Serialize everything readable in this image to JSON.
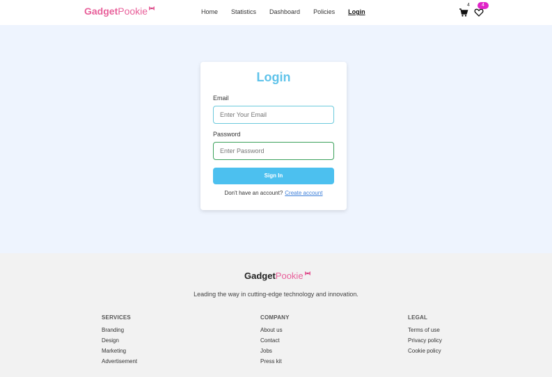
{
  "brand": {
    "prefix": "Gadget",
    "suffix": "Pookie",
    "color": "#e8609a"
  },
  "nav": {
    "links": [
      "Home",
      "Statistics",
      "Dashboard",
      "Policies",
      "Login"
    ],
    "active": "Login",
    "cart_count": "4",
    "wishlist_count": "4"
  },
  "login": {
    "title": "Login",
    "email_label": "Email",
    "email_placeholder": "Enter Your Email",
    "password_label": "Password",
    "password_placeholder": "Enter Password",
    "signin_label": "Sign In",
    "no_account_text": "Don't have an account?",
    "create_account_label": "Create account"
  },
  "footer": {
    "logo_prefix": "Gadget",
    "logo_suffix": "Pookie",
    "tagline": "Leading the way in cutting-edge technology and innovation.",
    "services": {
      "heading": "SERVICES",
      "items": [
        "Branding",
        "Design",
        "Marketing",
        "Advertisement"
      ]
    },
    "company": {
      "heading": "COMPANY",
      "items": [
        "About us",
        "Contact",
        "Jobs",
        "Press kit"
      ]
    },
    "legal": {
      "heading": "LEGAL",
      "items": [
        "Terms of use",
        "Privacy policy",
        "Cookie policy"
      ]
    }
  },
  "colors": {
    "accent": "#4cc0ef",
    "title": "#5fc3ea",
    "badge": "#e024c8",
    "page_bg": "#eef4fe"
  }
}
